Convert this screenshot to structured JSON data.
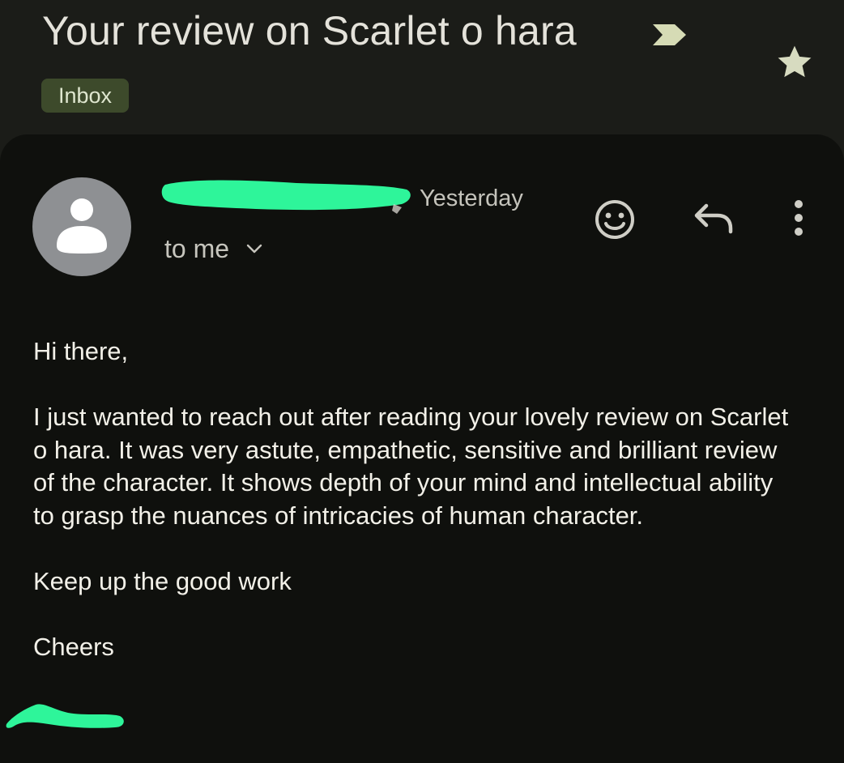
{
  "header": {
    "subject": "Your review on Scarlet o hara",
    "label": "Inbox"
  },
  "message": {
    "timestamp": "Yesterday",
    "recipient": "to me",
    "body": {
      "greeting": "Hi there,",
      "paragraph": "I just wanted to reach out after reading your lovely review on Scarlet o hara. It was very astute, empathetic, sensitive and brilliant review of the character. It shows depth of your mind and intellectual ability to grasp the nuances of intricacies of human character.",
      "closing": "Keep up the good work",
      "signoff": "Cheers"
    }
  },
  "icons": {
    "important": "important-marker-icon",
    "star": "star-icon",
    "avatar": "person-icon",
    "emoji": "add-reaction-icon",
    "reply": "reply-icon",
    "more": "more-vert-icon",
    "expand": "chevron-down-icon"
  },
  "colors": {
    "background": "#1b1c18",
    "card": "#0f100d",
    "label_chip": "#3d4a2b",
    "accent_star": "#d7dbc0",
    "redaction": "#2ef59a"
  }
}
